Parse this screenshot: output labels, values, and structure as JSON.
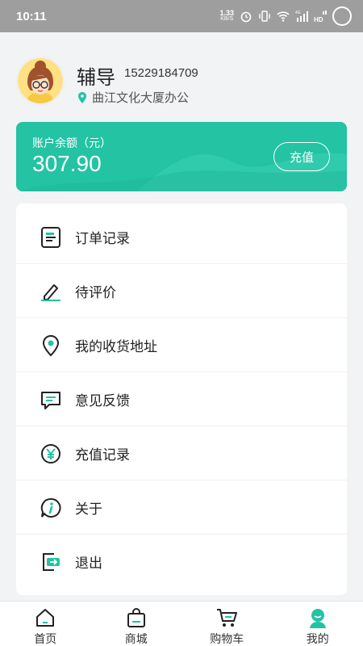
{
  "status_bar": {
    "time": "10:11",
    "speed_value": "1.33",
    "speed_unit": "KB/S",
    "network": "4G",
    "hd": "HD"
  },
  "profile": {
    "name": "辅导",
    "phone": "15229184709",
    "location": "曲江文化大厦办公"
  },
  "balance": {
    "label": "账户余额（元）",
    "value": "307.90",
    "recharge_label": "充值"
  },
  "menu": {
    "items": [
      {
        "label": "订单记录",
        "icon": "order-list-icon"
      },
      {
        "label": "待评价",
        "icon": "pen-icon"
      },
      {
        "label": "我的收货地址",
        "icon": "location-pin-icon"
      },
      {
        "label": "意见反馈",
        "icon": "feedback-chat-icon"
      },
      {
        "label": "充值记录",
        "icon": "yuan-coin-icon"
      },
      {
        "label": "关于",
        "icon": "info-icon"
      },
      {
        "label": "退出",
        "icon": "logout-icon"
      }
    ]
  },
  "tabbar": {
    "tabs": [
      {
        "label": "首页",
        "icon": "home-icon"
      },
      {
        "label": "商城",
        "icon": "shopping-bag-icon"
      },
      {
        "label": "购物车",
        "icon": "cart-icon"
      },
      {
        "label": "我的",
        "icon": "profile-icon",
        "active": true
      }
    ]
  },
  "colors": {
    "accent": "#23c3a4",
    "status_bar": "#9e9e9e",
    "background": "#f2f3f5"
  }
}
